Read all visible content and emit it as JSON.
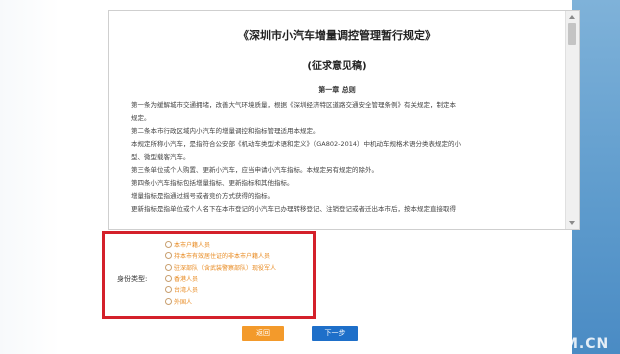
{
  "document": {
    "title": "《深圳市小汽车增量调控管理暂行规定》",
    "subtitle": "(征求意见稿)",
    "chapter": "第一章 总则",
    "paragraphs": [
      "第一条为缓解城市交通拥堵，改善大气环境质量，根据《深圳经济特区道路交通安全管理条例》有关规定，制定本",
      "规定。",
      "第二条本市行政区域内小汽车的增量调控和指标管理适用本规定。",
      "本规定所称小汽车，是指符合公安部《机动车类型术语和定义》（GA802-2014）中机动车规格术语分类表规定的小",
      "型、微型载客汽车。",
      "第三条单位或个人购置、更新小汽车，应当申请小汽车指标。本规定另有规定的除外。",
      "第四条小汽车指标包括增量指标、更新指标和其他指标。",
      "增量指标是指通过摇号或者竞价方式获得的指标。",
      "更新指标是指单位或个人名下在本市登记的小汽车已办理转移登记、注销登记或者迁出本市后，按本规定直接取得"
    ]
  },
  "identity": {
    "label": "身份类型:",
    "options": [
      "本市户籍人员",
      "持本市有效居住证的非本市户籍人员",
      "驻深部队（含武装警察部队）现役军人",
      "香港人员",
      "台湾人员",
      "外国人"
    ]
  },
  "buttons": {
    "back": "返回",
    "next": "下一步"
  },
  "watermark": "M.CN",
  "colors": {
    "highlight_border": "#d4202a",
    "option_text": "#e8891e",
    "back_button": "#f39a2b",
    "next_button": "#1e6fc9"
  }
}
